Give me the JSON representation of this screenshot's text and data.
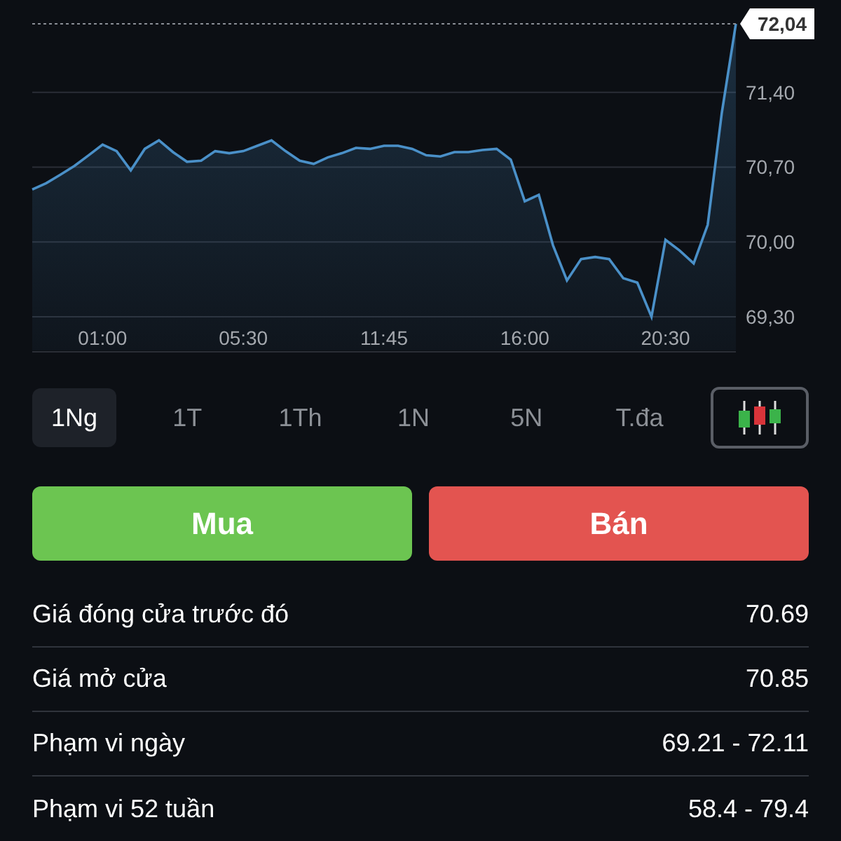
{
  "chart_data": {
    "type": "area",
    "categories": [
      null,
      null,
      null,
      null,
      null,
      "01:00",
      null,
      null,
      null,
      null,
      null,
      null,
      null,
      null,
      null,
      "05:30",
      null,
      null,
      null,
      null,
      null,
      null,
      null,
      null,
      null,
      "11:45",
      null,
      null,
      null,
      null,
      null,
      null,
      null,
      null,
      null,
      "16:00",
      null,
      null,
      null,
      null,
      null,
      null,
      null,
      null,
      null,
      "20:30",
      null,
      null,
      null,
      null,
      null
    ],
    "series": [
      {
        "color": "#4a90c8",
        "values": [
          70.49,
          70.55,
          70.63,
          70.71,
          70.81,
          70.91,
          70.85,
          70.67,
          70.87,
          70.95,
          70.84,
          70.75,
          70.76,
          70.85,
          70.83,
          70.85,
          70.9,
          70.95,
          70.85,
          70.76,
          70.73,
          70.79,
          70.83,
          70.88,
          70.87,
          70.9,
          70.9,
          70.87,
          70.81,
          70.8,
          70.84,
          70.84,
          70.86,
          70.87,
          70.77,
          70.38,
          70.44,
          69.97,
          69.64,
          69.84,
          69.86,
          69.84,
          69.66,
          69.62,
          69.3,
          70.02,
          69.92,
          69.8,
          70.16,
          71.21,
          72.04
        ]
      }
    ],
    "grid": true,
    "ylim": [
      69.3,
      72.04
    ],
    "yticks": [
      {
        "value": 69.3,
        "label": "69,30"
      },
      {
        "value": 70,
        "label": "70,00"
      },
      {
        "value": 70.7,
        "label": "70,70"
      },
      {
        "value": 71.4,
        "label": "71,40"
      }
    ]
  },
  "last_price": "72,04",
  "ranges": [
    {
      "label": "1Ng",
      "selected": true
    },
    {
      "label": "1T",
      "selected": false
    },
    {
      "label": "1Th",
      "selected": false
    },
    {
      "label": "1N",
      "selected": false
    },
    {
      "label": "5N",
      "selected": false
    },
    {
      "label": "T.đa",
      "selected": false
    }
  ],
  "actions": [
    {
      "label": "Mua",
      "kind": "buy"
    },
    {
      "label": "Bán",
      "kind": "sell"
    }
  ],
  "stats": [
    {
      "label": "Giá đóng cửa trước đó",
      "value": "70.69"
    },
    {
      "label": "Giá mở cửa",
      "value": "70.85"
    },
    {
      "label": "Phạm vi ngày",
      "value": "69.21 - 72.11"
    },
    {
      "label": "Phạm vi 52 tuần",
      "value": "58.4 - 79.4"
    }
  ]
}
